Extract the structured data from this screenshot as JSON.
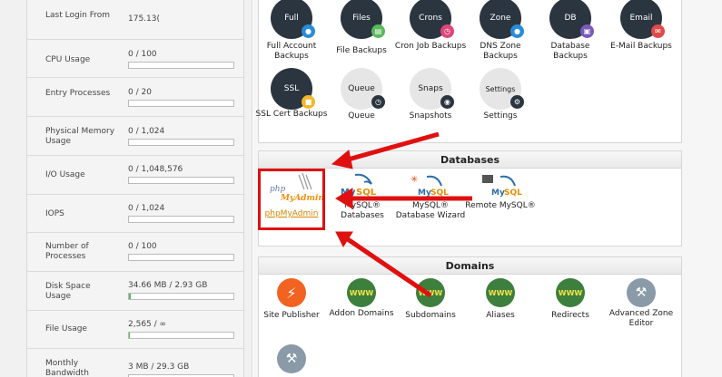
{
  "stats": [
    {
      "label": "Last Login From",
      "value": "175.13("
    },
    {
      "label": "CPU Usage",
      "value": "0 / 100",
      "fill": 0
    },
    {
      "label": "Entry Processes",
      "value": "0 / 20",
      "fill": 0
    },
    {
      "label": "Physical Memory Usage",
      "value": "0 / 1,024",
      "fill": 0
    },
    {
      "label": "I/O Usage",
      "value": "0 / 1,048,576",
      "fill": 0
    },
    {
      "label": "IOPS",
      "value": "0 / 1,024",
      "fill": 0
    },
    {
      "label": "Number of Processes",
      "value": "0 / 100",
      "fill": 0
    },
    {
      "label": "Disk Space Usage",
      "value": "34.66 MB / 2.93 GB",
      "fill": 0.012
    },
    {
      "label": "File Usage",
      "value": "2,565 / ∞",
      "fill": 0.006
    },
    {
      "label": "Monthly Bandwidth",
      "value": "3 MB / 29.3 GB",
      "fill": 0
    }
  ],
  "files": {
    "items": [
      {
        "icon_text": "Full",
        "label": "Full Account Backups",
        "badge_color": "#2a8bd8"
      },
      {
        "icon_text": "Files",
        "label": "File Backups",
        "badge_color": "#5cb85c"
      },
      {
        "icon_text": "Crons",
        "label": "Cron Job Backups",
        "badge_color": "#e0457b"
      },
      {
        "icon_text": "Zone",
        "label": "DNS Zone Backups",
        "badge_color": "#2a8bd8"
      },
      {
        "icon_text": "DB",
        "label": "Database Backups",
        "badge_color": "#7a5bb8"
      },
      {
        "icon_text": "Email",
        "label": "E-Mail Backups",
        "badge_color": "#e04a4a"
      },
      {
        "icon_text": "SSL",
        "label": "SSL Cert Backups",
        "badge_color": "#f0b92a"
      },
      {
        "icon_text": "Queue",
        "label": "Queue",
        "badge_color": "#2b3540"
      },
      {
        "icon_text": "Snaps",
        "label": "Snapshots",
        "badge_color": "#2b3540"
      },
      {
        "icon_text": "Settings",
        "label": "Settings",
        "badge_color": "#2b3540"
      }
    ]
  },
  "databases": {
    "title": "Databases",
    "items": [
      {
        "label": "phpMyAdmin",
        "logo_text": "phpMyAdmin"
      },
      {
        "label": "MySQL® Databases",
        "logo_text": "MySQL"
      },
      {
        "label": "MySQL® Database Wizard",
        "logo_text": "MySQL"
      },
      {
        "label": "Remote MySQL®",
        "logo_text": "MySQL"
      }
    ]
  },
  "domains": {
    "title": "Domains",
    "items": [
      {
        "label": "Site Publisher"
      },
      {
        "label": "Addon Domains"
      },
      {
        "label": "Subdomains"
      },
      {
        "label": "Aliases"
      },
      {
        "label": "Redirects"
      },
      {
        "label": "Advanced Zone Editor"
      }
    ]
  },
  "colors": {
    "arrow": "#e01010",
    "highlight": "#e01010",
    "link": "#d68400"
  }
}
